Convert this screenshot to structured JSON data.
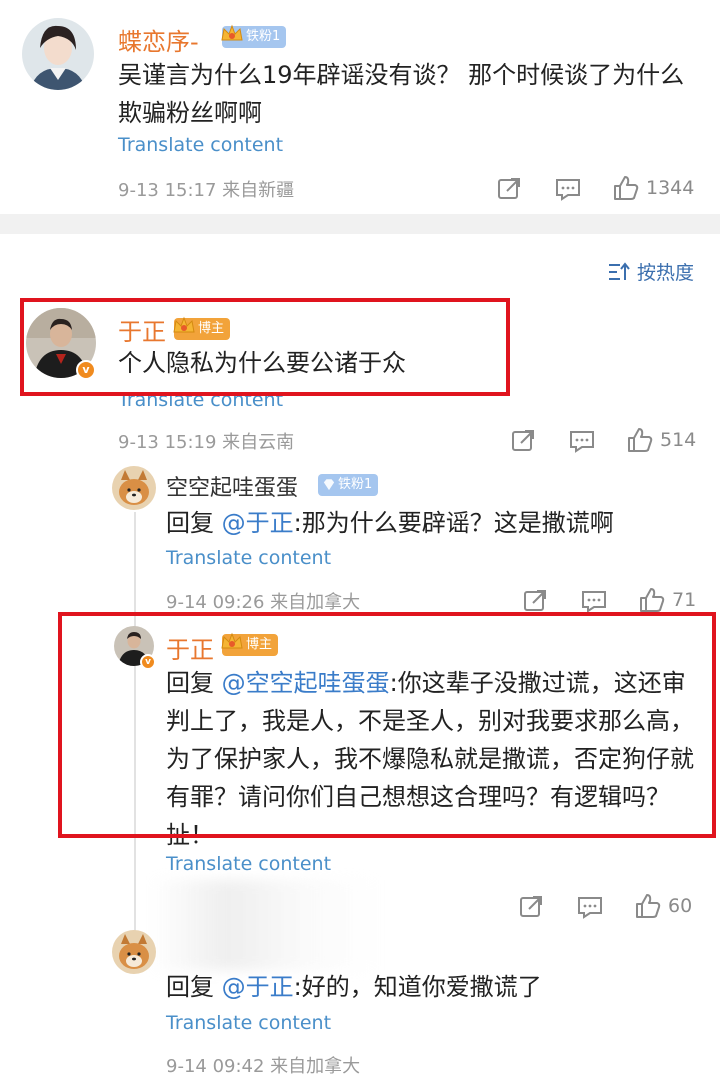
{
  "comments": {
    "top": {
      "username": "蝶恋序-",
      "badge": "铁粉1",
      "text": "吴谨言为什么19年辟谣没有谈？ 那个时候谈了为什么欺骗粉丝啊啊",
      "translate": "Translate content",
      "meta": "9-13 15:17  来自新疆",
      "likes": "1344"
    },
    "sort_label": "按热度",
    "main": {
      "username": "于正",
      "badge": "博主",
      "verified": "v",
      "text": "个人隐私为什么要公诸于众",
      "translate": "Translate content",
      "meta": "9-13 15:19  来自云南",
      "likes": "514"
    },
    "replies": [
      {
        "username": "空空起哇蛋蛋",
        "badge": "铁粉1",
        "prefix": "回复 ",
        "mention": "@于正",
        "text": ":那为什么要辟谣？这是撒谎啊",
        "translate": "Translate content",
        "meta": "9-14 09:26  来自加拿大",
        "likes": "71"
      },
      {
        "username": "于正",
        "badge": "博主",
        "prefix": "回复 ",
        "mention": "@空空起哇蛋蛋",
        "text": ":你这辈子没撒过谎，这还审判上了，我是人，不是圣人，别对我要求那么高，为了保护家人，我不爆隐私就是撒谎，否定狗仔就有罪？请问你们自己想想这合理吗？有逻辑吗？扯！",
        "translate": "Translate content",
        "likes": "60"
      },
      {
        "prefix": "回复 ",
        "mention": "@于正",
        "text": ":好的，知道你爱撒谎了",
        "translate": "Translate content",
        "meta": "9-14 09:42  来自加拿大"
      }
    ]
  },
  "colors": {
    "username": "#e8772e",
    "link": "#4a8fc9",
    "highlight_box": "#e0141e"
  }
}
